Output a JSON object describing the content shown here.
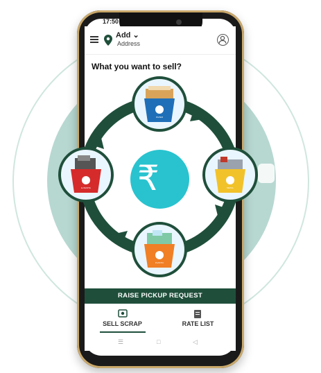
{
  "status": {
    "time": "17:50"
  },
  "header": {
    "address_title": "Add",
    "address_subtitle": "Address"
  },
  "main": {
    "prompt": "What you want to sell?",
    "center_symbol": "₹"
  },
  "bins": [
    {
      "name": "paper",
      "label": "PAPER",
      "color": "#1f6fb8"
    },
    {
      "name": "ewaste",
      "label": "E-WASTE",
      "color": "#d62b2b"
    },
    {
      "name": "metal",
      "label": "METAL",
      "color": "#f2c22a"
    },
    {
      "name": "plastic",
      "label": "PLASTIC",
      "color": "#f07f25"
    }
  ],
  "actions": {
    "raise_pickup": "RAISE PICKUP REQUEST"
  },
  "tabs": [
    {
      "label": "SELL SCRAP",
      "icon": "money-icon",
      "active": true
    },
    {
      "label": "RATE LIST",
      "icon": "document-icon",
      "active": false
    }
  ],
  "colors": {
    "brand": "#1f4f3b",
    "accent": "#28c3cf"
  }
}
